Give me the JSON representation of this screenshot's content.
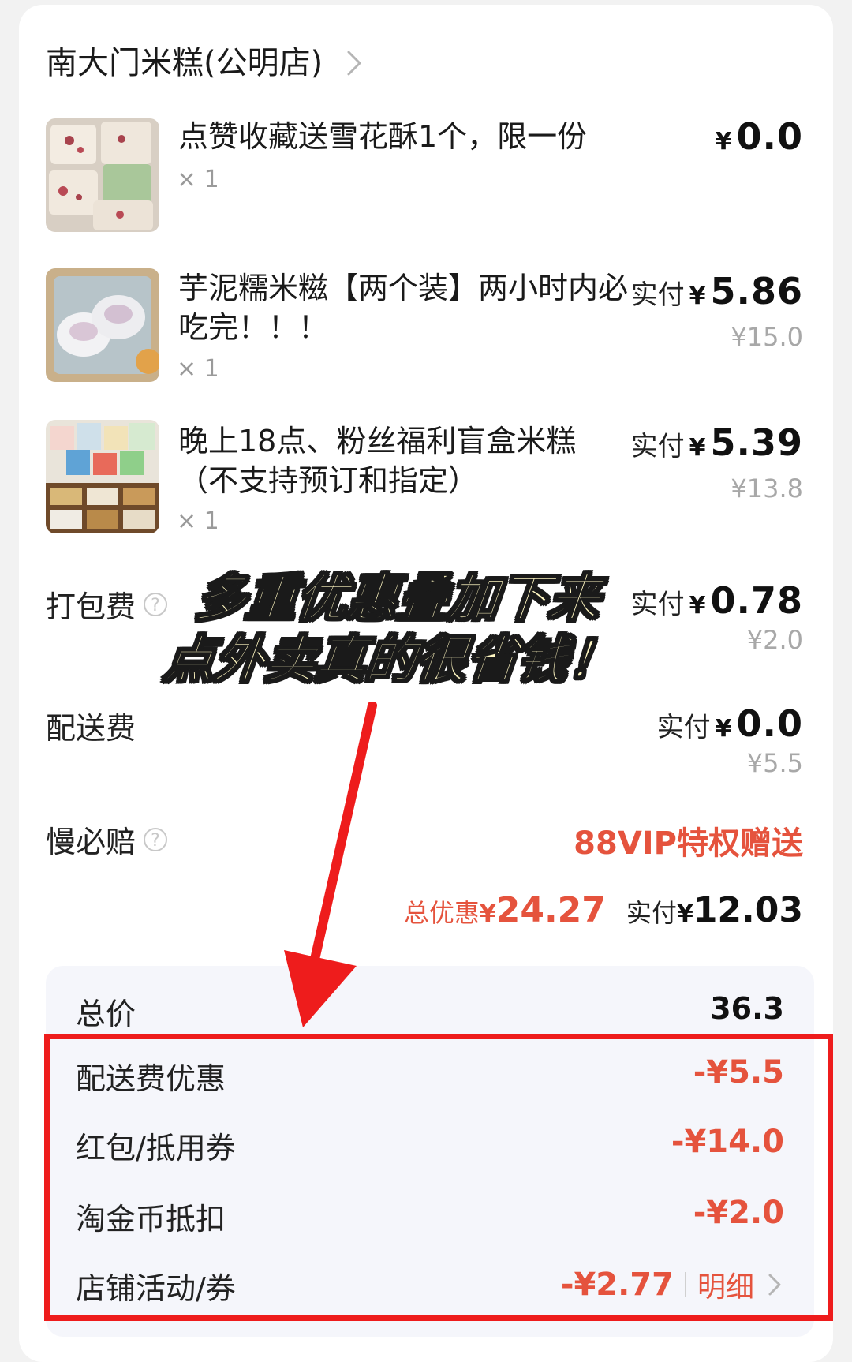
{
  "store": {
    "name": "南大门米糕(公明店)"
  },
  "items": [
    {
      "title": "点赞收藏送雪花酥1个，限一份",
      "qty": "× 1",
      "paid_label": "",
      "yen": "¥",
      "amount": "0.0",
      "original": ""
    },
    {
      "title": "芋泥糯米糍【两个装】两小时内必吃完！！！",
      "qty": "× 1",
      "paid_label": "实付",
      "yen": "¥",
      "amount": "5.86",
      "original": "¥15.0"
    },
    {
      "title": "晚上18点、粉丝福利盲盒米糕（不支持预订和指定）",
      "qty": "× 1",
      "paid_label": "实付",
      "yen": "¥",
      "amount": "5.39",
      "original": "¥13.8"
    }
  ],
  "fees": {
    "packing": {
      "label": "打包费",
      "paid_label": "实付",
      "yen": "¥",
      "amount": "0.78",
      "original": "¥2.0"
    },
    "delivery": {
      "label": "配送费",
      "paid_label": "实付",
      "yen": "¥",
      "amount": "0.0",
      "original": "¥5.5"
    },
    "slow_comp": {
      "label": "慢必赔",
      "value": "88VIP特权赠送"
    }
  },
  "summary": {
    "discount_label": "总优惠",
    "discount_yen": "¥",
    "discount_amount": "24.27",
    "paid_label": "实付",
    "paid_yen": "¥",
    "paid_amount": "12.03"
  },
  "breakdown": {
    "total_label": "总价",
    "total_value": "36.3",
    "rows": [
      {
        "label": "配送费优惠",
        "value": "-¥5.5"
      },
      {
        "label": "红包/抵用券",
        "value": "-¥14.0"
      },
      {
        "label": "淘金币抵扣",
        "value": "-¥2.0"
      },
      {
        "label": "店铺活动/券",
        "value": "-¥2.77"
      }
    ],
    "detail_label": "明细"
  },
  "overlay": {
    "line1": "多重优惠叠加下来",
    "line2": "点外卖真的很省钱！"
  },
  "colors": {
    "accent_red": "#e5533d",
    "annotation_red": "#ee1c1c",
    "overlay_fill": "#fff7c2"
  },
  "icons": {
    "store_chevron": "chevron-right-icon",
    "help": "question-circle-icon",
    "detail_chevron": "chevron-right-icon",
    "annotation_arrow": "arrow-down-icon"
  }
}
